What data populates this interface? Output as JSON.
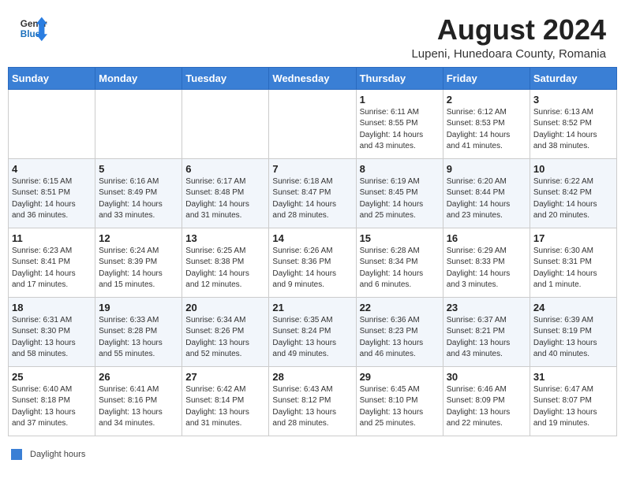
{
  "header": {
    "logo_general": "General",
    "logo_blue": "Blue",
    "month_year": "August 2024",
    "location": "Lupeni, Hunedoara County, Romania"
  },
  "columns": [
    "Sunday",
    "Monday",
    "Tuesday",
    "Wednesday",
    "Thursday",
    "Friday",
    "Saturday"
  ],
  "legend": {
    "label": "Daylight hours"
  },
  "weeks": [
    [
      {
        "day": "",
        "info": ""
      },
      {
        "day": "",
        "info": ""
      },
      {
        "day": "",
        "info": ""
      },
      {
        "day": "",
        "info": ""
      },
      {
        "day": "1",
        "info": "Sunrise: 6:11 AM\nSunset: 8:55 PM\nDaylight: 14 hours\nand 43 minutes."
      },
      {
        "day": "2",
        "info": "Sunrise: 6:12 AM\nSunset: 8:53 PM\nDaylight: 14 hours\nand 41 minutes."
      },
      {
        "day": "3",
        "info": "Sunrise: 6:13 AM\nSunset: 8:52 PM\nDaylight: 14 hours\nand 38 minutes."
      }
    ],
    [
      {
        "day": "4",
        "info": "Sunrise: 6:15 AM\nSunset: 8:51 PM\nDaylight: 14 hours\nand 36 minutes."
      },
      {
        "day": "5",
        "info": "Sunrise: 6:16 AM\nSunset: 8:49 PM\nDaylight: 14 hours\nand 33 minutes."
      },
      {
        "day": "6",
        "info": "Sunrise: 6:17 AM\nSunset: 8:48 PM\nDaylight: 14 hours\nand 31 minutes."
      },
      {
        "day": "7",
        "info": "Sunrise: 6:18 AM\nSunset: 8:47 PM\nDaylight: 14 hours\nand 28 minutes."
      },
      {
        "day": "8",
        "info": "Sunrise: 6:19 AM\nSunset: 8:45 PM\nDaylight: 14 hours\nand 25 minutes."
      },
      {
        "day": "9",
        "info": "Sunrise: 6:20 AM\nSunset: 8:44 PM\nDaylight: 14 hours\nand 23 minutes."
      },
      {
        "day": "10",
        "info": "Sunrise: 6:22 AM\nSunset: 8:42 PM\nDaylight: 14 hours\nand 20 minutes."
      }
    ],
    [
      {
        "day": "11",
        "info": "Sunrise: 6:23 AM\nSunset: 8:41 PM\nDaylight: 14 hours\nand 17 minutes."
      },
      {
        "day": "12",
        "info": "Sunrise: 6:24 AM\nSunset: 8:39 PM\nDaylight: 14 hours\nand 15 minutes."
      },
      {
        "day": "13",
        "info": "Sunrise: 6:25 AM\nSunset: 8:38 PM\nDaylight: 14 hours\nand 12 minutes."
      },
      {
        "day": "14",
        "info": "Sunrise: 6:26 AM\nSunset: 8:36 PM\nDaylight: 14 hours\nand 9 minutes."
      },
      {
        "day": "15",
        "info": "Sunrise: 6:28 AM\nSunset: 8:34 PM\nDaylight: 14 hours\nand 6 minutes."
      },
      {
        "day": "16",
        "info": "Sunrise: 6:29 AM\nSunset: 8:33 PM\nDaylight: 14 hours\nand 3 minutes."
      },
      {
        "day": "17",
        "info": "Sunrise: 6:30 AM\nSunset: 8:31 PM\nDaylight: 14 hours\nand 1 minute."
      }
    ],
    [
      {
        "day": "18",
        "info": "Sunrise: 6:31 AM\nSunset: 8:30 PM\nDaylight: 13 hours\nand 58 minutes."
      },
      {
        "day": "19",
        "info": "Sunrise: 6:33 AM\nSunset: 8:28 PM\nDaylight: 13 hours\nand 55 minutes."
      },
      {
        "day": "20",
        "info": "Sunrise: 6:34 AM\nSunset: 8:26 PM\nDaylight: 13 hours\nand 52 minutes."
      },
      {
        "day": "21",
        "info": "Sunrise: 6:35 AM\nSunset: 8:24 PM\nDaylight: 13 hours\nand 49 minutes."
      },
      {
        "day": "22",
        "info": "Sunrise: 6:36 AM\nSunset: 8:23 PM\nDaylight: 13 hours\nand 46 minutes."
      },
      {
        "day": "23",
        "info": "Sunrise: 6:37 AM\nSunset: 8:21 PM\nDaylight: 13 hours\nand 43 minutes."
      },
      {
        "day": "24",
        "info": "Sunrise: 6:39 AM\nSunset: 8:19 PM\nDaylight: 13 hours\nand 40 minutes."
      }
    ],
    [
      {
        "day": "25",
        "info": "Sunrise: 6:40 AM\nSunset: 8:18 PM\nDaylight: 13 hours\nand 37 minutes."
      },
      {
        "day": "26",
        "info": "Sunrise: 6:41 AM\nSunset: 8:16 PM\nDaylight: 13 hours\nand 34 minutes."
      },
      {
        "day": "27",
        "info": "Sunrise: 6:42 AM\nSunset: 8:14 PM\nDaylight: 13 hours\nand 31 minutes."
      },
      {
        "day": "28",
        "info": "Sunrise: 6:43 AM\nSunset: 8:12 PM\nDaylight: 13 hours\nand 28 minutes."
      },
      {
        "day": "29",
        "info": "Sunrise: 6:45 AM\nSunset: 8:10 PM\nDaylight: 13 hours\nand 25 minutes."
      },
      {
        "day": "30",
        "info": "Sunrise: 6:46 AM\nSunset: 8:09 PM\nDaylight: 13 hours\nand 22 minutes."
      },
      {
        "day": "31",
        "info": "Sunrise: 6:47 AM\nSunset: 8:07 PM\nDaylight: 13 hours\nand 19 minutes."
      }
    ]
  ]
}
